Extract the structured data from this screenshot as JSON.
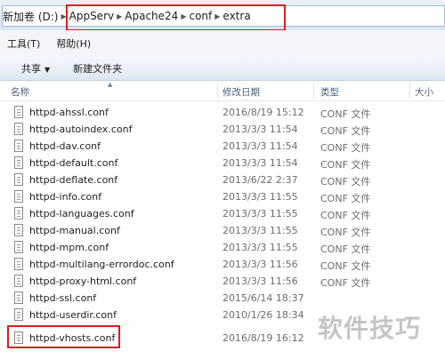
{
  "breadcrumb": [
    "新加卷 (D:)",
    "AppServ",
    "Apache24",
    "conf",
    "extra"
  ],
  "menu": [
    "工具(T)",
    "帮助(H)"
  ],
  "toolbar": {
    "share_label": "共享",
    "new_folder_label": "新建文件夹"
  },
  "columns": {
    "name": "名称",
    "date": "修改日期",
    "type": "类型",
    "size": "大小"
  },
  "files": [
    {
      "name": "httpd-ahssl.conf",
      "date": "2016/8/19 15:12",
      "type": "CONF 文件"
    },
    {
      "name": "httpd-autoindex.conf",
      "date": "2013/3/3 11:54",
      "type": "CONF 文件"
    },
    {
      "name": "httpd-dav.conf",
      "date": "2013/3/3 11:54",
      "type": "CONF 文件"
    },
    {
      "name": "httpd-default.conf",
      "date": "2013/3/3 11:54",
      "type": "CONF 文件"
    },
    {
      "name": "httpd-deflate.conf",
      "date": "2013/6/22 2:37",
      "type": "CONF 文件"
    },
    {
      "name": "httpd-info.conf",
      "date": "2013/3/3 11:55",
      "type": "CONF 文件"
    },
    {
      "name": "httpd-languages.conf",
      "date": "2013/3/3 11:55",
      "type": "CONF 文件"
    },
    {
      "name": "httpd-manual.conf",
      "date": "2013/3/3 11:55",
      "type": "CONF 文件"
    },
    {
      "name": "httpd-mpm.conf",
      "date": "2013/3/3 11:55",
      "type": "CONF 文件"
    },
    {
      "name": "httpd-multilang-errordoc.conf",
      "date": "2013/3/3 11:56",
      "type": "CONF 文件"
    },
    {
      "name": "httpd-proxy-html.conf",
      "date": "2013/3/3 11:56",
      "type": "CONF 文件"
    },
    {
      "name": "httpd-ssl.conf",
      "date": "2015/6/14 18:37",
      "type": ""
    },
    {
      "name": "httpd-userdir.conf",
      "date": "2010/1/26 18:34",
      "type": ""
    },
    {
      "name": "httpd-vhosts.conf",
      "date": "2016/8/19 16:12",
      "type": ""
    }
  ],
  "watermark": "软件技巧",
  "highlight_color": "#d72020"
}
